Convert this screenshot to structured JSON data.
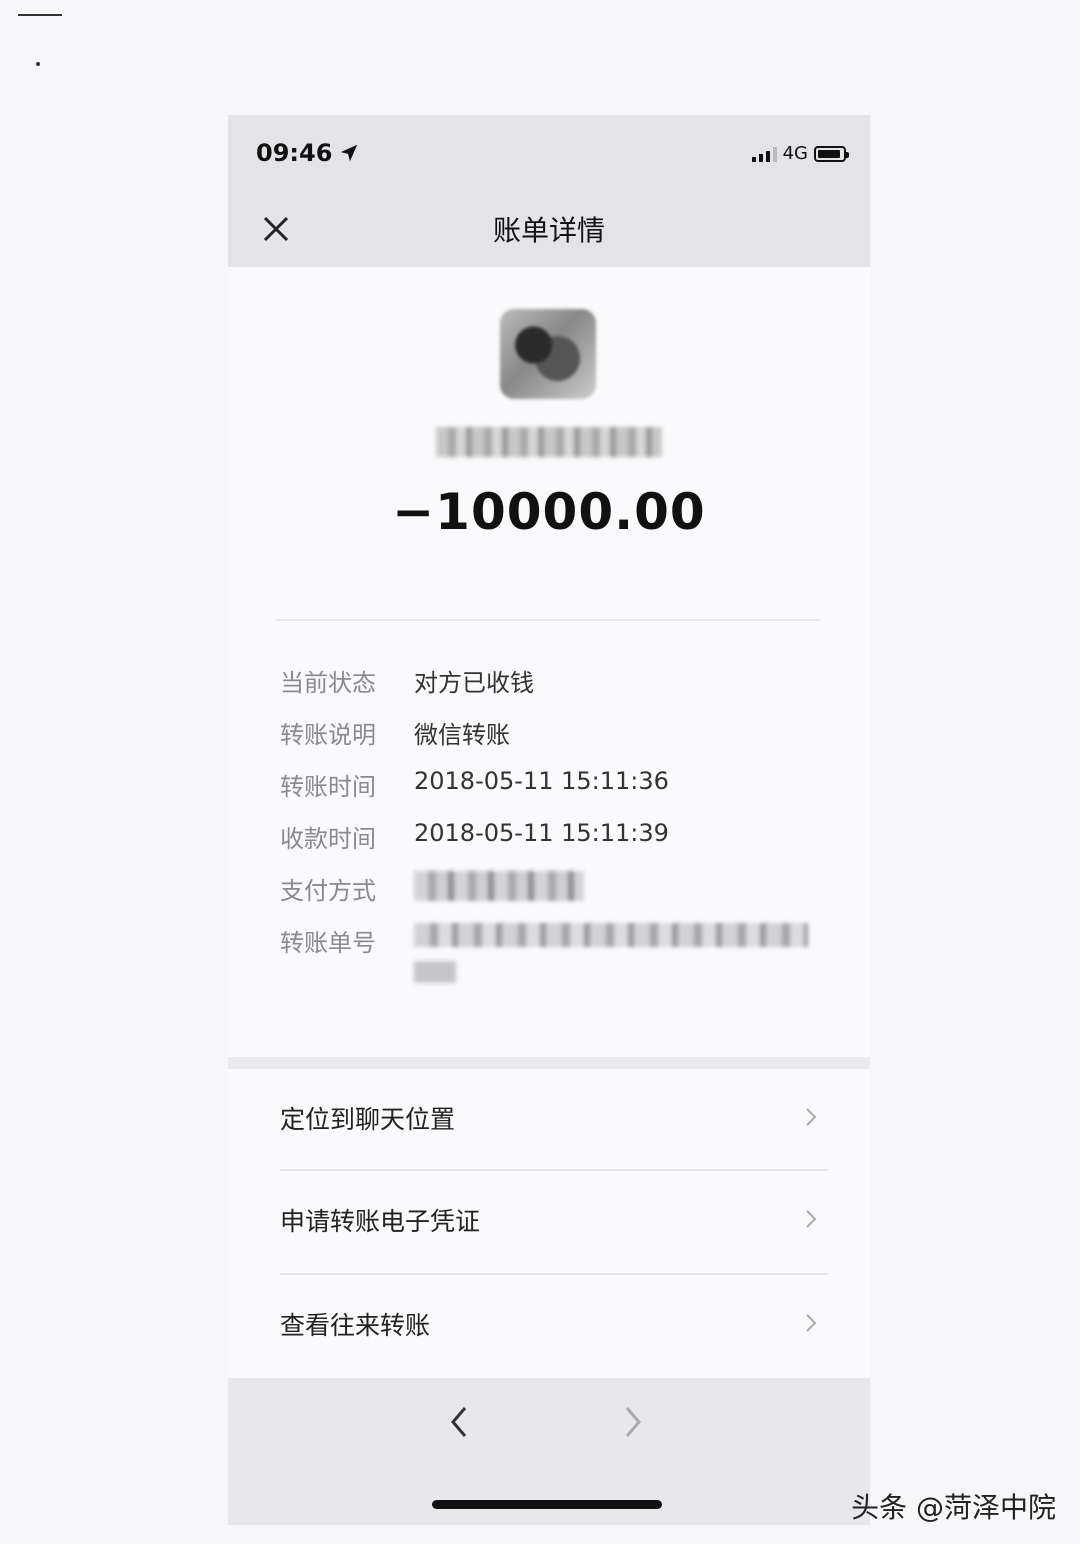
{
  "status_bar": {
    "time": "09:46",
    "network": "4G"
  },
  "header": {
    "title": "账单详情"
  },
  "amount": "−10000.00",
  "details": [
    {
      "label": "当前状态",
      "value": "对方已收钱"
    },
    {
      "label": "转账说明",
      "value": "微信转账"
    },
    {
      "label": "转账时间",
      "value": "2018-05-11 15:11:36"
    },
    {
      "label": "收款时间",
      "value": "2018-05-11 15:11:39"
    },
    {
      "label": "支付方式",
      "value": ""
    },
    {
      "label": "转账单号",
      "value": ""
    }
  ],
  "menu": [
    {
      "label": "定位到聊天位置"
    },
    {
      "label": "申请转账电子凭证"
    },
    {
      "label": "查看往来转账"
    }
  ],
  "watermark": "头条 @菏泽中院"
}
